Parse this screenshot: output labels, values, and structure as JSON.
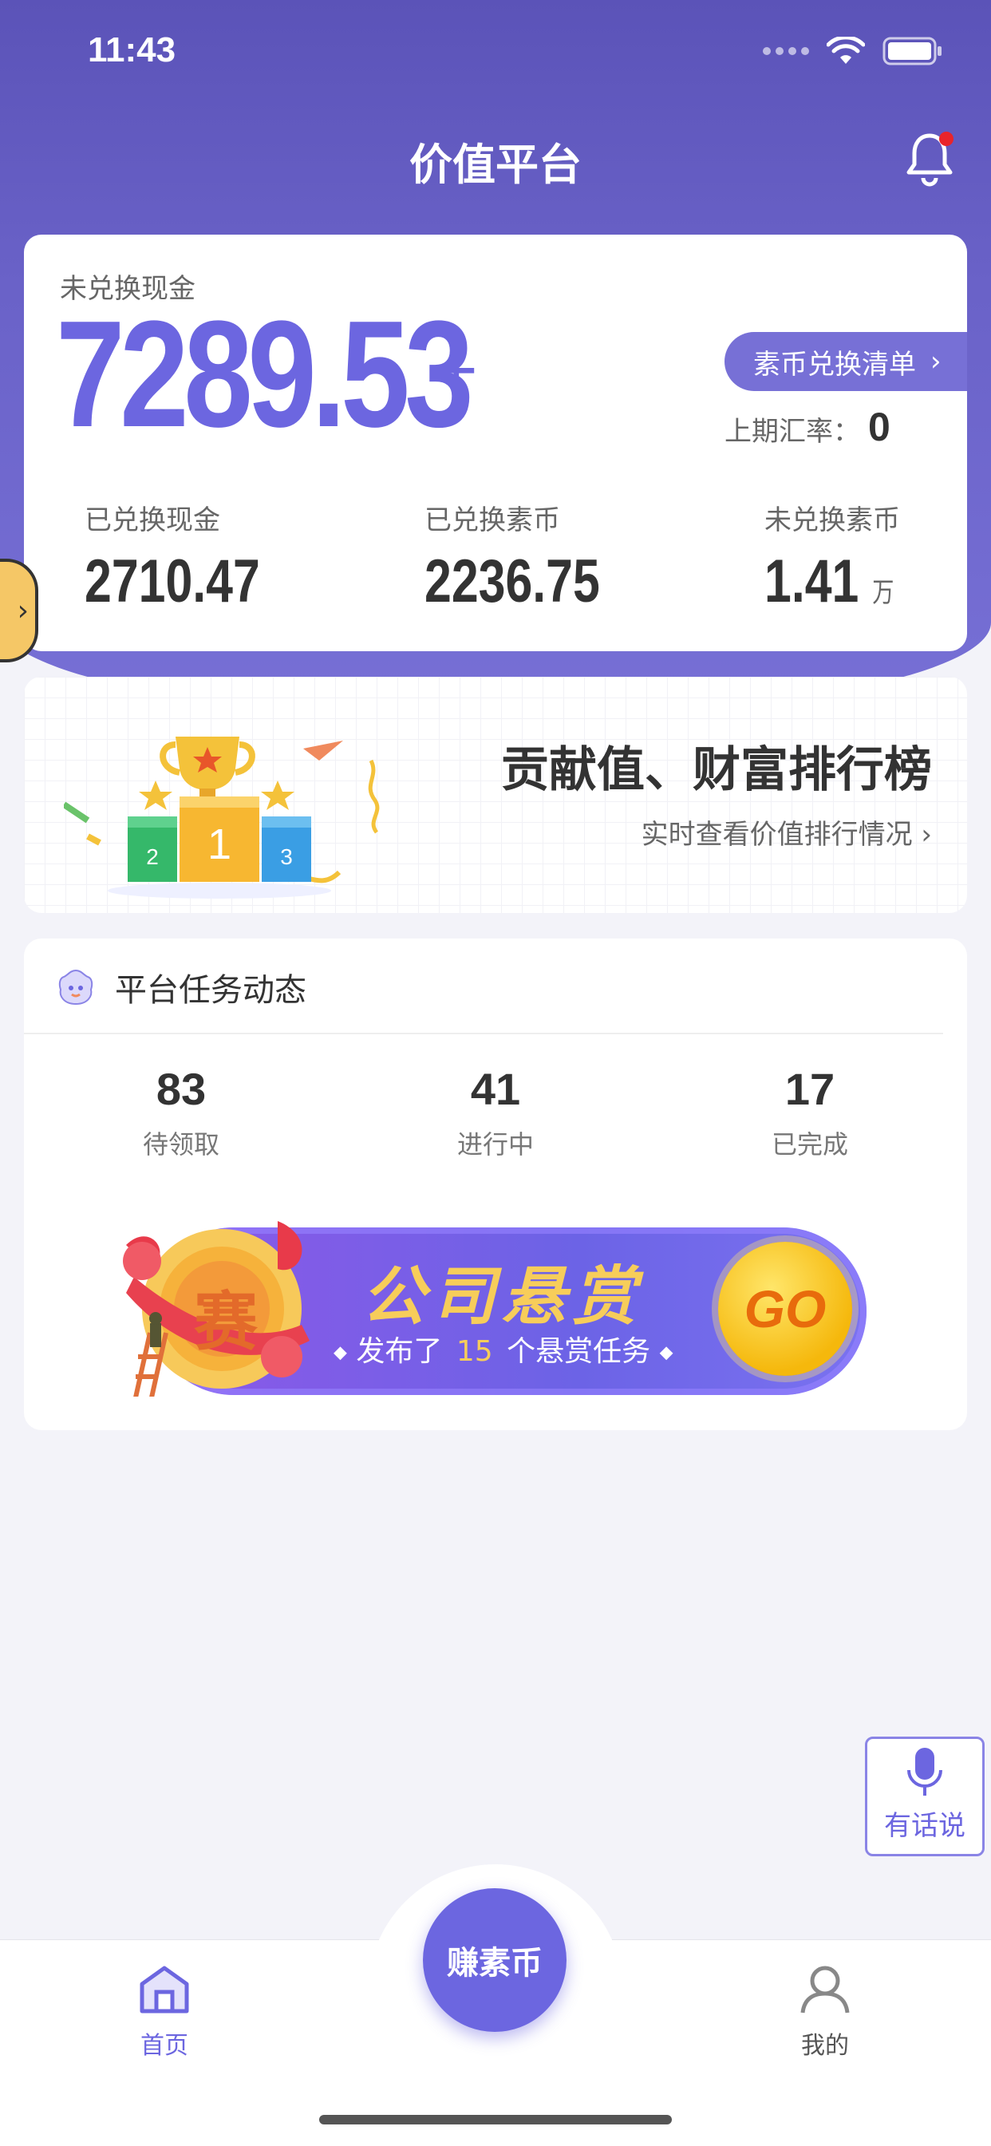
{
  "status_bar": {
    "time": "11:43"
  },
  "header": {
    "title": "价值平台"
  },
  "summary": {
    "unexchanged_cash_label": "未兑换现金",
    "unexchanged_cash_value": "7289.53",
    "plus": "+",
    "exchange_list_button": "素币兑换清单",
    "last_rate_label": "上期汇率：",
    "last_rate_value": "0",
    "stats": [
      {
        "label": "已兑换现金",
        "value": "2710.47",
        "unit": ""
      },
      {
        "label": "已兑换素币",
        "value": "2236.75",
        "unit": ""
      },
      {
        "label": "未兑换素币",
        "value": "1.41",
        "unit": "万"
      }
    ]
  },
  "ranking": {
    "title": "贡献值、财富排行榜",
    "subtitle": "实时查看价值排行情况",
    "podium_labels": [
      "2",
      "1",
      "3"
    ]
  },
  "tasks": {
    "title": "平台任务动态",
    "stats": [
      {
        "count": "83",
        "label": "待领取"
      },
      {
        "count": "41",
        "label": "进行中"
      },
      {
        "count": "17",
        "label": "已完成"
      }
    ],
    "banner": {
      "title": "公司悬赏",
      "sub_prefix": "发布了",
      "sub_count": "15",
      "sub_suffix": "个悬赏任务",
      "medal_text": "赛",
      "go": "GO"
    }
  },
  "voice_button": {
    "label": "有话说"
  },
  "tab_bar": {
    "home": "首页",
    "center": "赚素币",
    "mine": "我的"
  },
  "colors": {
    "primary": "#6c66e0",
    "accent_gold": "#f7cd5a",
    "notification_dot": "#e8242b"
  },
  "icons": [
    "bell-icon",
    "home-icon",
    "user-icon",
    "mic-icon",
    "wifi-icon",
    "battery-icon",
    "chevron-right-icon",
    "trophy-icon"
  ]
}
